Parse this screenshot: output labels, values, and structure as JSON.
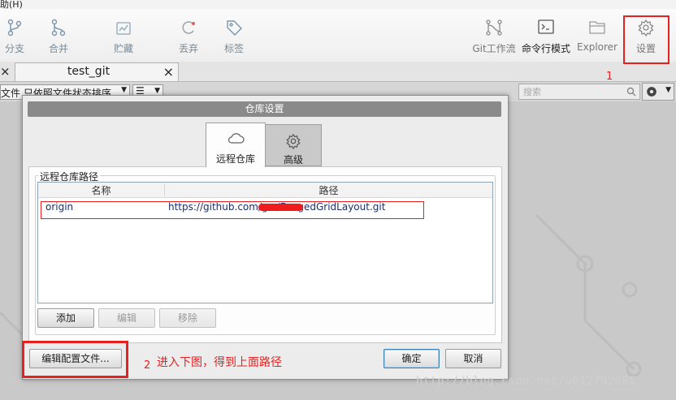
{
  "menubar": {
    "text": "助(H)"
  },
  "toolbar": {
    "branch": "分支",
    "merge": "合并",
    "stash": "贮藏",
    "discard": "丢弃",
    "tag": "标签",
    "git_flow": "Git工作流",
    "terminal": "命令行模式",
    "explorer": "Explorer",
    "settings": "设置"
  },
  "tabs": {
    "active_tab": "test_git",
    "close_glyph": "×"
  },
  "filterbar": {
    "sort_value": "文件 只依照文件状态排序",
    "menu_glyph": "☰",
    "search_placeholder": "搜索"
  },
  "dialog": {
    "title": "仓库设置",
    "tabs": [
      {
        "label": "远程仓库"
      },
      {
        "label": "高级"
      }
    ],
    "group_label": "远程仓库路径",
    "columns": {
      "name": "名称",
      "path": "路径"
    },
    "remotes": [
      {
        "name": "origin",
        "url": "https://github.com/g          e/DragedGridLayout.git"
      }
    ],
    "buttons": {
      "add": "添加",
      "edit": "编辑",
      "remove": "移除",
      "edit_config": "编辑配置文件...",
      "ok": "确定",
      "cancel": "取消"
    }
  },
  "annotations": {
    "marker1": "1",
    "marker2": "2",
    "note": "进入下图，得到上面路径",
    "color": "#e82020"
  },
  "watermark": "http://blog.csdn.net/u012792686"
}
